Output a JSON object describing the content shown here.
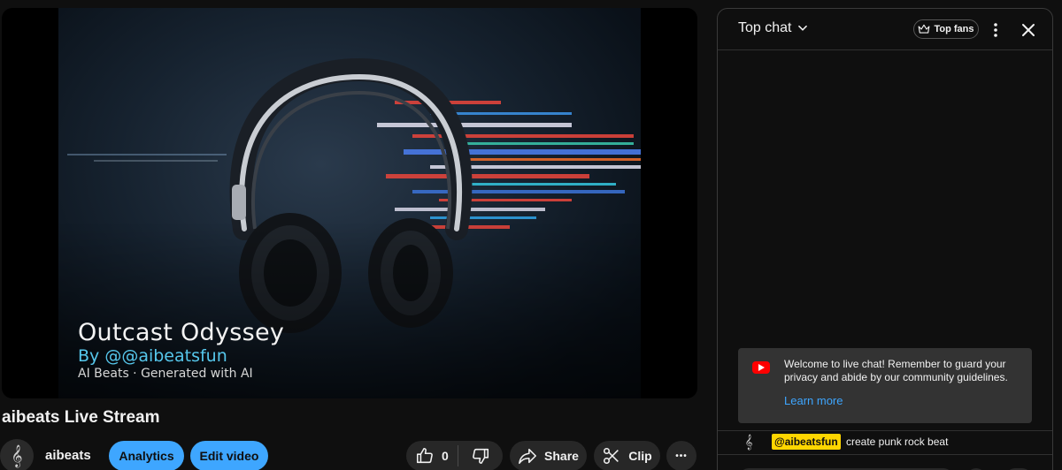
{
  "player": {
    "title": "Outcast Odyssey",
    "byline": "By @@aibeatsfun",
    "subtitle": "AI Beats · Generated with AI"
  },
  "stream": {
    "title": "aibeats Live Stream"
  },
  "channel": {
    "avatar_icon": "treble-clef-icon",
    "avatar_glyph": "𝄞",
    "name": "aibeats"
  },
  "actions": {
    "analytics_label": "Analytics",
    "edit_label": "Edit video",
    "like_count": "0",
    "share_label": "Share",
    "clip_label": "Clip",
    "more_glyph": "•••"
  },
  "chat": {
    "mode_label": "Top chat",
    "top_fans_label": "Top fans",
    "welcome_text": "Welcome to live chat! Remember to guard your privacy and abide by our community guidelines.",
    "learn_more_label": "Learn more",
    "messages": [
      {
        "avatar_glyph": "𝄞",
        "author": "@aibeatsfun",
        "text": "create punk rock beat"
      }
    ]
  },
  "colors": {
    "accent": "#3ea6ff",
    "background": "#0f0f0f",
    "button": "#272727",
    "author_badge": "#ffd600",
    "youtube_red": "#ff0000",
    "byline": "#56c7ec"
  }
}
